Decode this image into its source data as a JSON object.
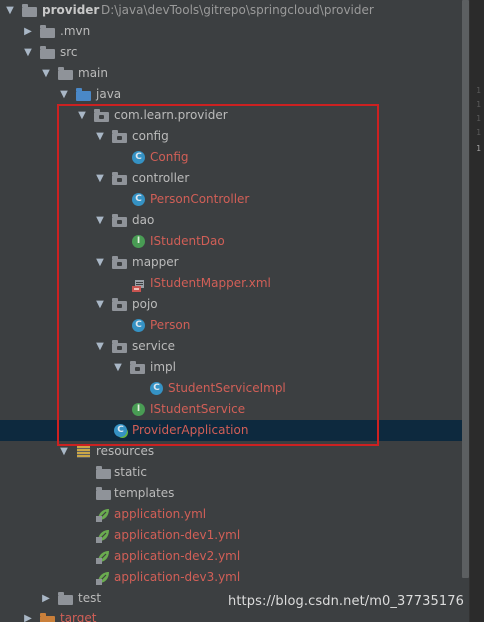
{
  "project": {
    "name": "provider",
    "path": "D:\\java\\devTools\\gitrepo\\springcloud\\provider"
  },
  "tree": {
    "mvn": ".mvn",
    "src": "src",
    "main": "main",
    "java": "java",
    "package": "com.learn.provider",
    "config_folder": "config",
    "config_class": "Config",
    "controller_folder": "controller",
    "person_controller": "PersonController",
    "dao_folder": "dao",
    "student_dao": "IStudentDao",
    "mapper_folder": "mapper",
    "student_mapper_xml": "IStudentMapper.xml",
    "pojo_folder": "pojo",
    "person": "Person",
    "service_folder": "service",
    "impl_folder": "impl",
    "student_service_impl": "StudentServiceImpl",
    "student_service": "IStudentService",
    "provider_application": "ProviderApplication",
    "resources": "resources",
    "static": "static",
    "templates": "templates",
    "application_yml": "application.yml",
    "application_dev1": "application-dev1.yml",
    "application_dev2": "application-dev2.yml",
    "application_dev3": "application-dev3.yml",
    "test": "test",
    "target": "target"
  },
  "icons": {
    "class": "C",
    "interface": "I"
  },
  "gutter": [
    "1",
    "1",
    "1",
    "1",
    "1"
  ],
  "watermark": "https://blog.csdn.net/m0_37735176",
  "colors": {
    "background": "#3c3f41",
    "selection": "#0d293e",
    "highlight_box": "#cc2121",
    "modified_file": "#d15f57",
    "class_icon": "#3592c4",
    "interface_icon": "#499c54"
  }
}
